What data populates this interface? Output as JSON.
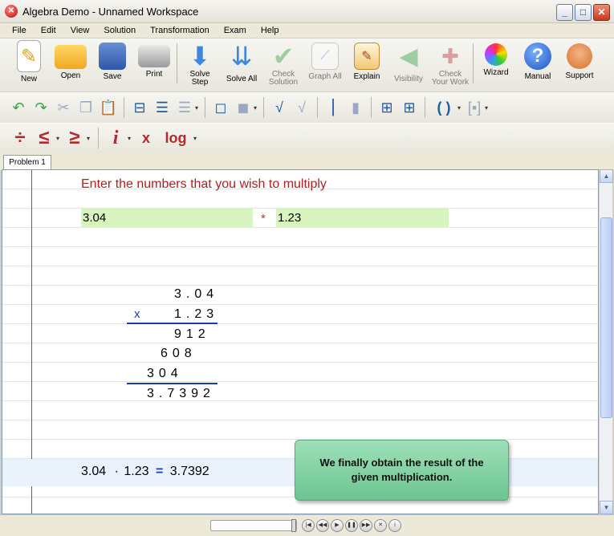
{
  "window": {
    "title": "Algebra Demo - Unnamed Workspace",
    "controls": [
      "_",
      "□",
      "✕"
    ]
  },
  "menu": [
    "File",
    "Edit",
    "View",
    "Solution",
    "Transformation",
    "Exam",
    "Help"
  ],
  "toolbar": {
    "new": "New",
    "open": "Open",
    "save": "Save",
    "print": "Print",
    "solve_step_1": "Solve",
    "solve_step_2": "Step",
    "solve_all": "Solve All",
    "check_solution_1": "Check",
    "check_solution_2": "Solution",
    "graph_all": "Graph All",
    "explain": "Explain",
    "visibility": "Visibility",
    "check_work_1": "Check",
    "check_work_2": "Your Work",
    "wizard": "Wizard",
    "manual": "Manual",
    "support": "Support"
  },
  "math_toolbar": {
    "divide": "÷",
    "le": "≤",
    "ge": "≥",
    "imag": "i",
    "subscript": "x",
    "log": "log",
    "parens": "( )"
  },
  "tabs": [
    "Problem 1"
  ],
  "problem": {
    "prompt": "Enter the numbers that you wish to multiply",
    "left": "3.04",
    "operator": "*",
    "right": "1.23"
  },
  "long_multiplication": {
    "multiplicand": "3.04",
    "multiplier_sign": "x",
    "multiplier": "1.23",
    "partials": [
      "912",
      "608",
      "304"
    ],
    "result": "3.7392"
  },
  "result_line": {
    "a": "3.04",
    "op": "·",
    "b": "1.23",
    "eq": "=",
    "value": "3.7392"
  },
  "hint": "We finally obtain the result of the given multiplication.",
  "colors": {
    "accent_blue": "#1e3ca8",
    "prompt_red": "#b02020",
    "input_green": "#d8f5c0",
    "hint_green": "#7fd3a0"
  }
}
